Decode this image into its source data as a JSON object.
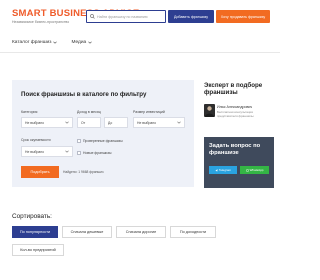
{
  "header": {
    "logo_title": "SMART BUSINESS ADVICE",
    "logo_subtitle": "Независимое бизнес-пространство",
    "search_placeholder": "Найти франшизу по названию",
    "add_button": "Добавить франшизу",
    "sell_button": "Хочу продавать франшизу"
  },
  "nav": {
    "items": [
      {
        "label": "Каталог франшиз"
      },
      {
        "label": "Медиа"
      }
    ]
  },
  "filter": {
    "title": "Поиск франшизы в каталоге по фильтру",
    "category_label": "Категория",
    "category_value": "Не выбрано",
    "income_label": "Доход в месяц",
    "income_from": "От",
    "income_to": "До",
    "investment_label": "Размер инвестиций",
    "investment_value": "Не выбрано",
    "payback_label": "Срок окупаемости",
    "payback_value": "Не выбрано",
    "checkbox_verified": "Проверенные франшизы",
    "checkbox_new": "Новые франшизы",
    "search_button": "Подобрать",
    "found_text": "Найдено: 1 9668 франшиз"
  },
  "expert": {
    "title": "Эксперт в подборе франшизы",
    "name": "Илья Александрович",
    "description": "Бесплатная консультация представителя франшизы",
    "ask_title": "Задать вопрос по франшизе",
    "telegram_button": "Telegram",
    "whatsapp_button": "WhatsApp"
  },
  "sort": {
    "title": "Сортировать:",
    "options": [
      {
        "label": "По популярности",
        "active": true
      },
      {
        "label": "Сначала дешевые",
        "active": false
      },
      {
        "label": "Сначала дорогие",
        "active": false
      },
      {
        "label": "По доходности",
        "active": false
      },
      {
        "label": "Кол-во предприятий",
        "active": false
      }
    ]
  },
  "colors": {
    "brand_orange": "#f26b21",
    "brand_blue": "#2d3e91",
    "panel_bg": "#eef1f8",
    "ask_bg": "#3f4a5c",
    "telegram": "#2aa3e0",
    "whatsapp": "#34b545"
  }
}
